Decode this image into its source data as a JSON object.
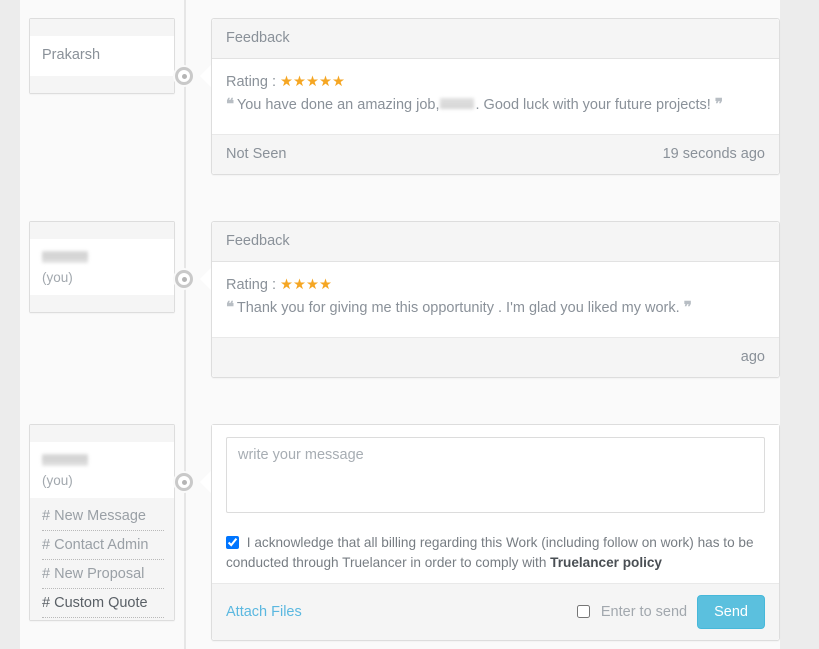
{
  "timeline": [
    {
      "side_card": {
        "name": "Prakarsh",
        "name_redacted": false,
        "you_label": ""
      },
      "panel": {
        "title": "Feedback",
        "rating_label": "Rating :",
        "rating": 5,
        "stars": "★★★★★",
        "open_quote": "❝",
        "close_quote": "❞",
        "message_before": "You have done an amazing job,",
        "message_redacted": true,
        "message_after": ". Good luck with your future projects!",
        "status": "Not Seen",
        "time": "19 seconds ago"
      }
    },
    {
      "side_card": {
        "name": "",
        "name_redacted": true,
        "you_label": "(you)"
      },
      "panel": {
        "title": "Feedback",
        "rating_label": "Rating :",
        "rating": 4,
        "stars": "★★★★",
        "open_quote": "❝",
        "close_quote": "❞",
        "message_before": "Thank you for giving me this opportunity . I'm glad you liked my work.",
        "message_redacted": false,
        "message_after": "",
        "status": "",
        "time": "ago"
      }
    }
  ],
  "compose": {
    "side_card": {
      "name": "",
      "name_redacted": true,
      "you_label": "(you)",
      "menu": [
        {
          "label": "# New Message",
          "active": false
        },
        {
          "label": "# Contact Admin",
          "active": false
        },
        {
          "label": "# New Proposal",
          "active": false
        },
        {
          "label": "# Custom Quote",
          "active": true
        }
      ]
    },
    "message_placeholder": "write your message",
    "message_value": "",
    "acknowledge": {
      "checked": true,
      "text_part1": "I acknowledge that all billing regarding this Work (including follow on work) has to be conducted through Truelancer in order to comply with ",
      "policy_link": "Truelancer policy"
    },
    "attach_label": "Attach Files",
    "enter_to_send_label": "Enter to send",
    "enter_to_send_checked": false,
    "send_label": "Send"
  },
  "colors": {
    "star": "#f5a623",
    "send_button": "#5bc0de",
    "link": "#5bb8e0",
    "page_background": "#ececec",
    "workspace_background": "#fafafa"
  }
}
